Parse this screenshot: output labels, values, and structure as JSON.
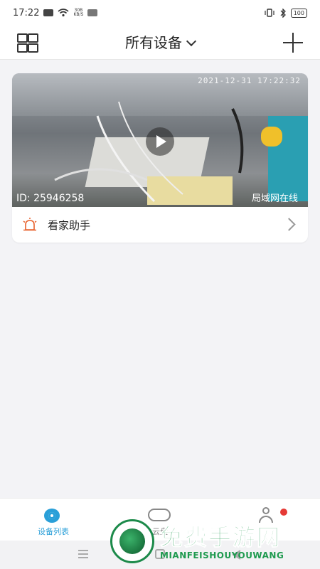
{
  "status_bar": {
    "time": "17:22",
    "net_speed_value": "30B",
    "net_speed_unit": "KB/S",
    "battery": "100"
  },
  "header": {
    "title": "所有设备"
  },
  "device_card": {
    "timestamp": "2021-12-31  17:22:32",
    "device_id": "ID: 25946258",
    "status": "局域网在线",
    "row_label": "看家助手"
  },
  "tabbar": {
    "tabs": [
      {
        "label": "设备列表",
        "active": true
      },
      {
        "label": "云盘",
        "active": false
      },
      {
        "label": "",
        "active": false
      }
    ]
  },
  "watermark": {
    "title": "免费手游网",
    "subtitle": "MIANFEISHOUYOUWANG"
  },
  "colors": {
    "accent": "#2a9fd8",
    "alarm": "#e8612c",
    "badge": "#e53935",
    "background": "#f3f3f6"
  }
}
